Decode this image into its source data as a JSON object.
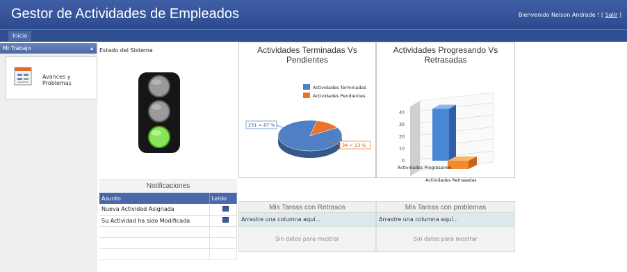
{
  "header": {
    "title": "Gestor de Actividades de Empleados",
    "welcome": "Bienvenido Nelson Andrade ! [",
    "logout": "Salir",
    "welcome_end": "]"
  },
  "nav": {
    "home": "Inicio"
  },
  "sidebar": {
    "section": "Mi Trabajo",
    "items": [
      {
        "label": "Avances y Problemas",
        "icon": "notepad-icon"
      }
    ]
  },
  "estado": {
    "label": "Estado del Sistema",
    "active_light": "green"
  },
  "chart1": {
    "title": "Actividades Terminadas Vs Pendientes",
    "chart_data": {
      "type": "pie",
      "labels": [
        "Actividades Terminadas",
        "Actividades Pendientes"
      ],
      "values": [
        231,
        34
      ],
      "data_labels": [
        "231 = 87 %",
        "34 = 13 %"
      ],
      "colors": [
        "#4f7fc4",
        "#e8742a"
      ],
      "legend": "top-right"
    }
  },
  "chart2": {
    "title": "Actividades Progresando Vs Retrasadas",
    "chart_data": {
      "type": "bar",
      "categories": [
        "Actividades Progresando",
        "Actividades Retrasadas"
      ],
      "values": [
        43,
        7
      ],
      "yticks": [
        "0",
        "10",
        "20",
        "30",
        "40"
      ],
      "ylim": [
        0,
        45
      ],
      "colors": [
        "#4a86d6",
        "#f08c2e"
      ]
    }
  },
  "notifications": {
    "title": "Notificaciones",
    "columns": [
      "Asunto",
      "Leido"
    ],
    "rows": [
      {
        "subject": "Nueva Actividad Asignada",
        "read": true
      },
      {
        "subject": "Su Actividad ha sido Modificada",
        "read": true
      }
    ]
  },
  "grids": {
    "retrasos": {
      "title": "Mis Tareas con Retrasos",
      "group": "Arrastre una columna aquí...",
      "empty": "Sin datos para mostrar"
    },
    "problemas": {
      "title": "Mis Tareas con problemas",
      "group": "Arrastre una columna aquí...",
      "empty": "Sin datos para mostrar"
    }
  }
}
